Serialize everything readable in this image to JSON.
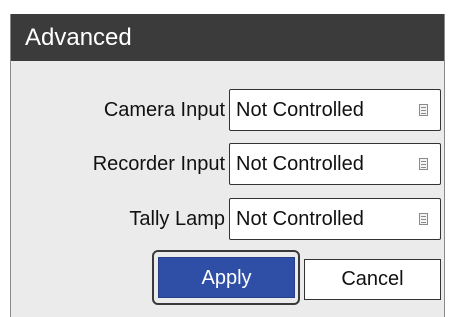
{
  "dialog": {
    "title": "Advanced",
    "fields": [
      {
        "label": "Camera Input",
        "value": "Not Controlled",
        "icon": "list-icon"
      },
      {
        "label": "Recorder Input",
        "value": "Not Controlled",
        "icon": "list-icon"
      },
      {
        "label": "Tally Lamp",
        "value": "Not Controlled",
        "icon": "list-icon"
      }
    ],
    "buttons": {
      "apply_label": "Apply",
      "cancel_label": "Cancel"
    }
  },
  "colors": {
    "titlebar": "#3b3b3b",
    "panel": "#ebebeb",
    "apply_button": "#2f4fa6"
  }
}
